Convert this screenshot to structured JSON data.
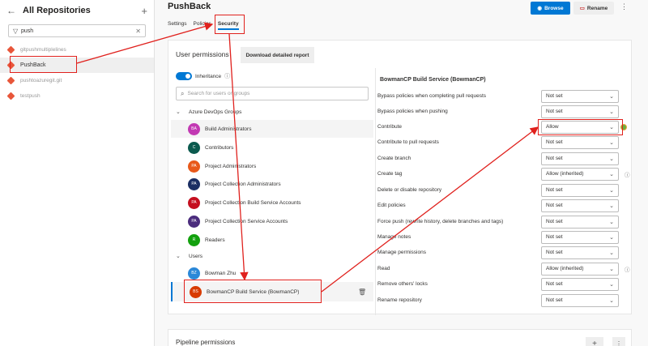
{
  "sidebar": {
    "title": "All Repositories",
    "filter_value": "push",
    "repos": [
      {
        "label": "gitpushmultiplelines",
        "selected": false
      },
      {
        "label": "PushBack",
        "selected": true
      },
      {
        "label": "pushtoazuregit.git",
        "selected": false
      },
      {
        "label": "testpush",
        "selected": false
      }
    ]
  },
  "header": {
    "title": "PushBack",
    "browse_label": "Browse",
    "rename_label": "Rename"
  },
  "tabs": [
    {
      "label": "Settings",
      "active": false
    },
    {
      "label": "Policies",
      "active": false
    },
    {
      "label": "Security",
      "active": true
    }
  ],
  "permissions_card": {
    "title": "User permissions",
    "report_button": "Download detailed report",
    "inheritance_label": "Inheritance",
    "search_placeholder": "Search for users or groups",
    "groups_header": "Azure DevOps Groups",
    "users_header": "Users",
    "groups": [
      {
        "initials": "BA",
        "name": "Build Administrators",
        "color": "#c239b3"
      },
      {
        "initials": "C",
        "name": "Contributors",
        "color": "#0b5a4e"
      },
      {
        "initials": "PA",
        "name": "Project Administrators",
        "color": "#e8591a"
      },
      {
        "initials": "PA",
        "name": "Project Collection Administrators",
        "color": "#1b2e63"
      },
      {
        "initials": "PA",
        "name": "Project Collection Build Service Accounts",
        "color": "#c50f1f"
      },
      {
        "initials": "PA",
        "name": "Project Collection Service Accounts",
        "color": "#4b2c7d"
      },
      {
        "initials": "R",
        "name": "Readers",
        "color": "#13a10e"
      }
    ],
    "users": [
      {
        "initials": "BZ",
        "name": "Bowman Zhu",
        "color": "#2b88d8"
      },
      {
        "initials": "BS",
        "name": "BowmanCP Build Service (BowmanCP)",
        "color": "#d83b01"
      }
    ]
  },
  "details": {
    "title": "BowmanCP Build Service (BowmanCP)",
    "permissions": [
      {
        "label": "Bypass policies when completing pull requests",
        "value": "Not set"
      },
      {
        "label": "Bypass policies when pushing",
        "value": "Not set"
      },
      {
        "label": "Contribute",
        "value": "Allow"
      },
      {
        "label": "Contribute to pull requests",
        "value": "Not set"
      },
      {
        "label": "Create branch",
        "value": "Not set"
      },
      {
        "label": "Create tag",
        "value": "Allow (inherited)"
      },
      {
        "label": "Delete or disable repository",
        "value": "Not set"
      },
      {
        "label": "Edit policies",
        "value": "Not set"
      },
      {
        "label": "Force push (rewrite history, delete branches and tags)",
        "value": "Not set"
      },
      {
        "label": "Manage notes",
        "value": "Not set"
      },
      {
        "label": "Manage permissions",
        "value": "Not set"
      },
      {
        "label": "Read",
        "value": "Allow (inherited)"
      },
      {
        "label": "Remove others' locks",
        "value": "Not set"
      },
      {
        "label": "Rename repository",
        "value": "Not set"
      }
    ]
  },
  "pipeline_card": {
    "title": "Pipeline permissions"
  },
  "colors": {
    "accent": "#0078d4",
    "annotation": "#e0211d"
  }
}
